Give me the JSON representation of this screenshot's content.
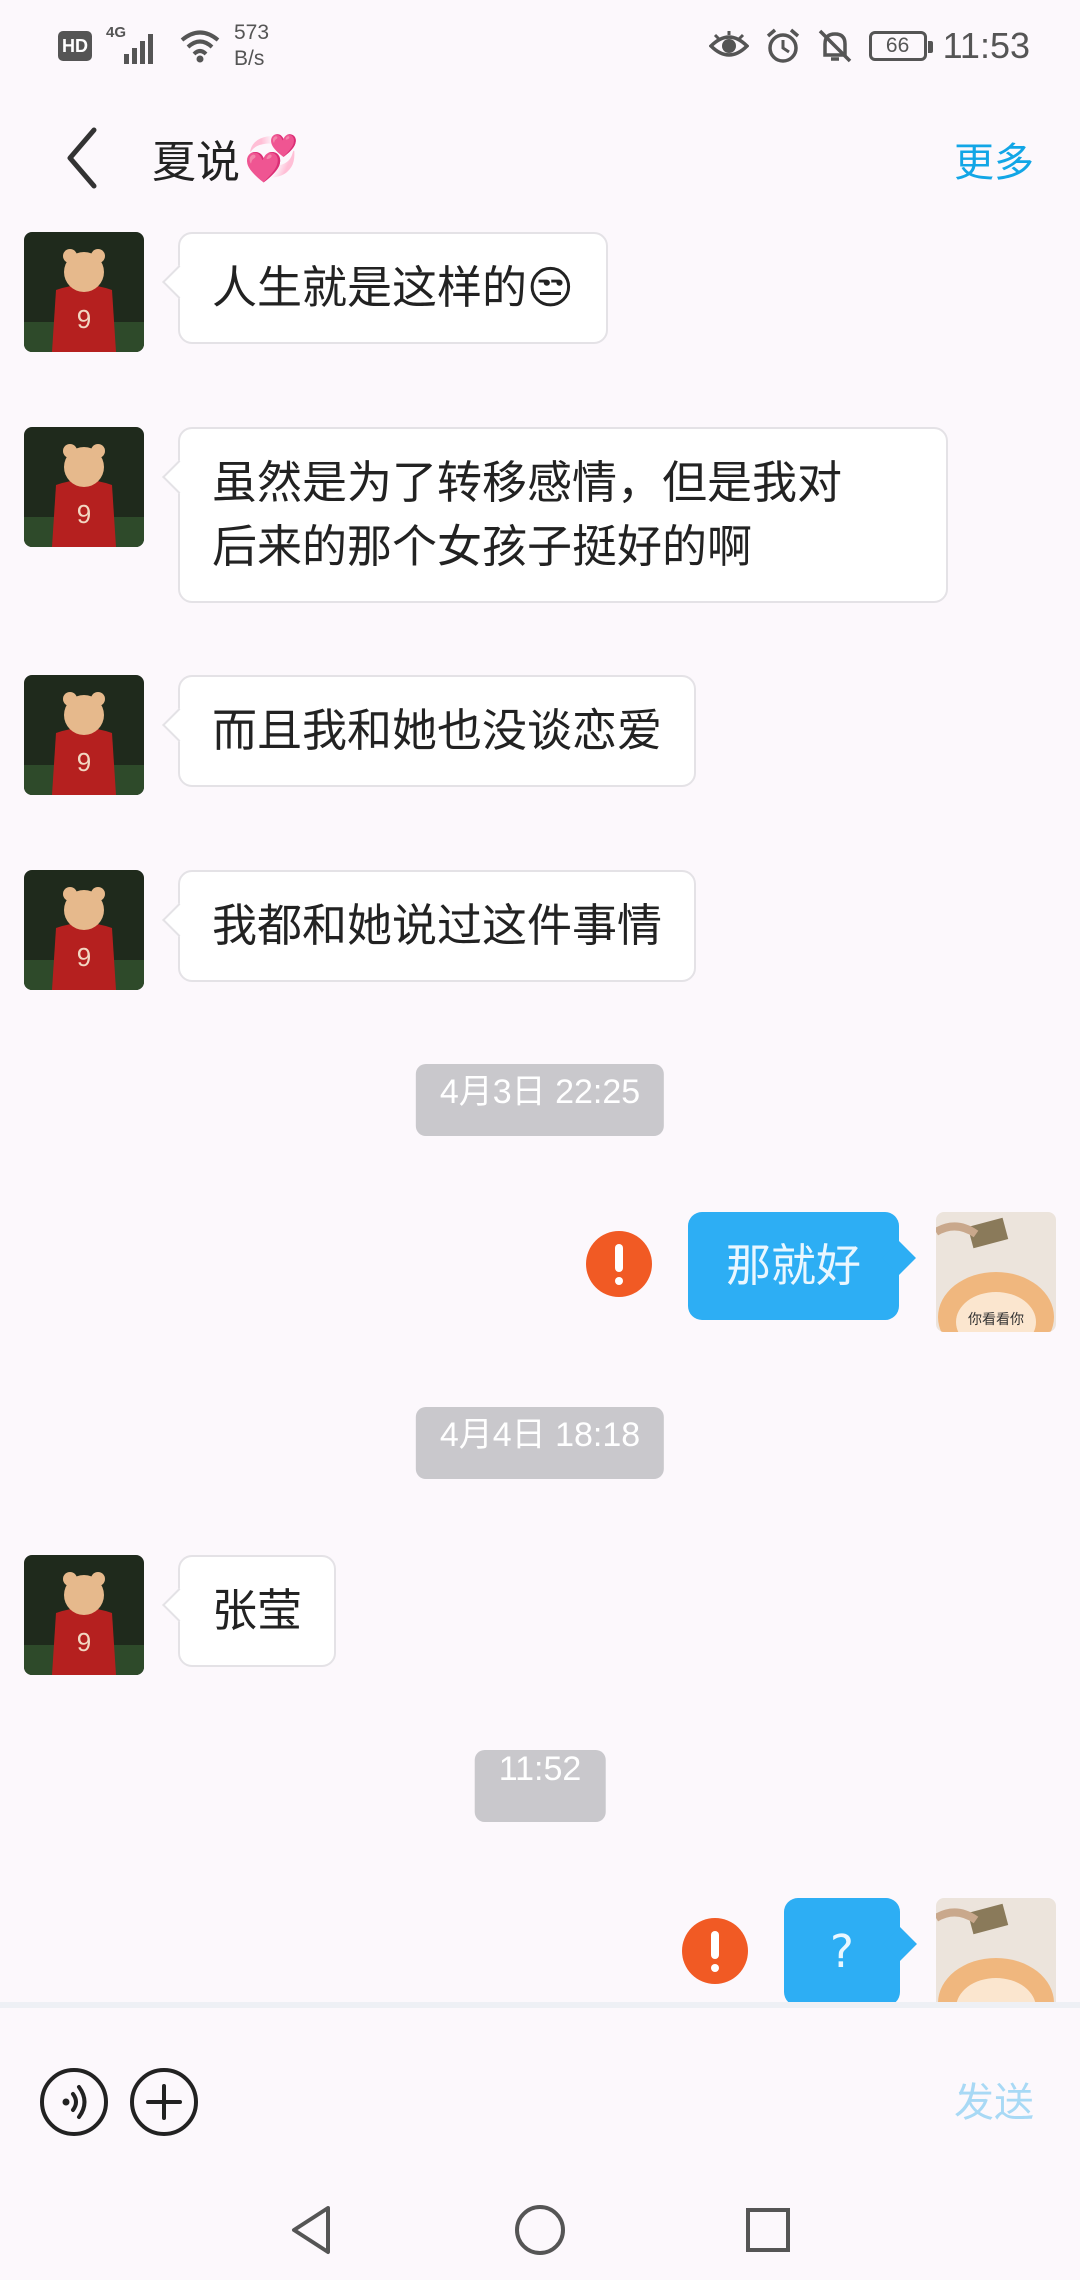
{
  "status_bar": {
    "hd_badge": "HD",
    "network_type": "4G",
    "net_speed_value": "573",
    "net_speed_unit": "B/s",
    "battery_level": "66",
    "time": "11:53",
    "icons": [
      "eye-icon",
      "alarm-icon",
      "mute-icon",
      "battery-icon"
    ]
  },
  "header": {
    "title": "夏说",
    "title_emoji": "💞",
    "more_label": "更多"
  },
  "messages": [
    {
      "type": "incoming",
      "text": "人生就是这样的",
      "emoji": "😒"
    },
    {
      "type": "incoming",
      "lines": [
        "虽然是为了转移感情，但是我对",
        "后来的那个女孩子挺好的啊"
      ]
    },
    {
      "type": "incoming",
      "text": "而且我和她也没谈恋爱"
    },
    {
      "type": "incoming",
      "text": "我都和她说过这件事情"
    },
    {
      "type": "timestamp",
      "text": "4月3日 22:25"
    },
    {
      "type": "outgoing",
      "text": "那就好",
      "status": "failed",
      "avatar_caption": "你看看你"
    },
    {
      "type": "timestamp",
      "text": "4月4日 18:18"
    },
    {
      "type": "incoming",
      "text": "张莹"
    },
    {
      "type": "timestamp",
      "text": "11:52"
    },
    {
      "type": "outgoing",
      "text": "?",
      "status": "failed"
    }
  ],
  "input_bar": {
    "voice_icon": "voice-icon",
    "add_icon": "plus-icon",
    "send_label": "发送"
  },
  "nav_bar": {
    "items": [
      "back-triangle-icon",
      "home-circle-icon",
      "recents-square-icon"
    ]
  },
  "colors": {
    "background": "#fcf8fc",
    "accent": "#12a6e6",
    "outgoing_bubble": "#2daef4",
    "error": "#f15a24",
    "timestamp_bg": "#c9c8cc"
  }
}
